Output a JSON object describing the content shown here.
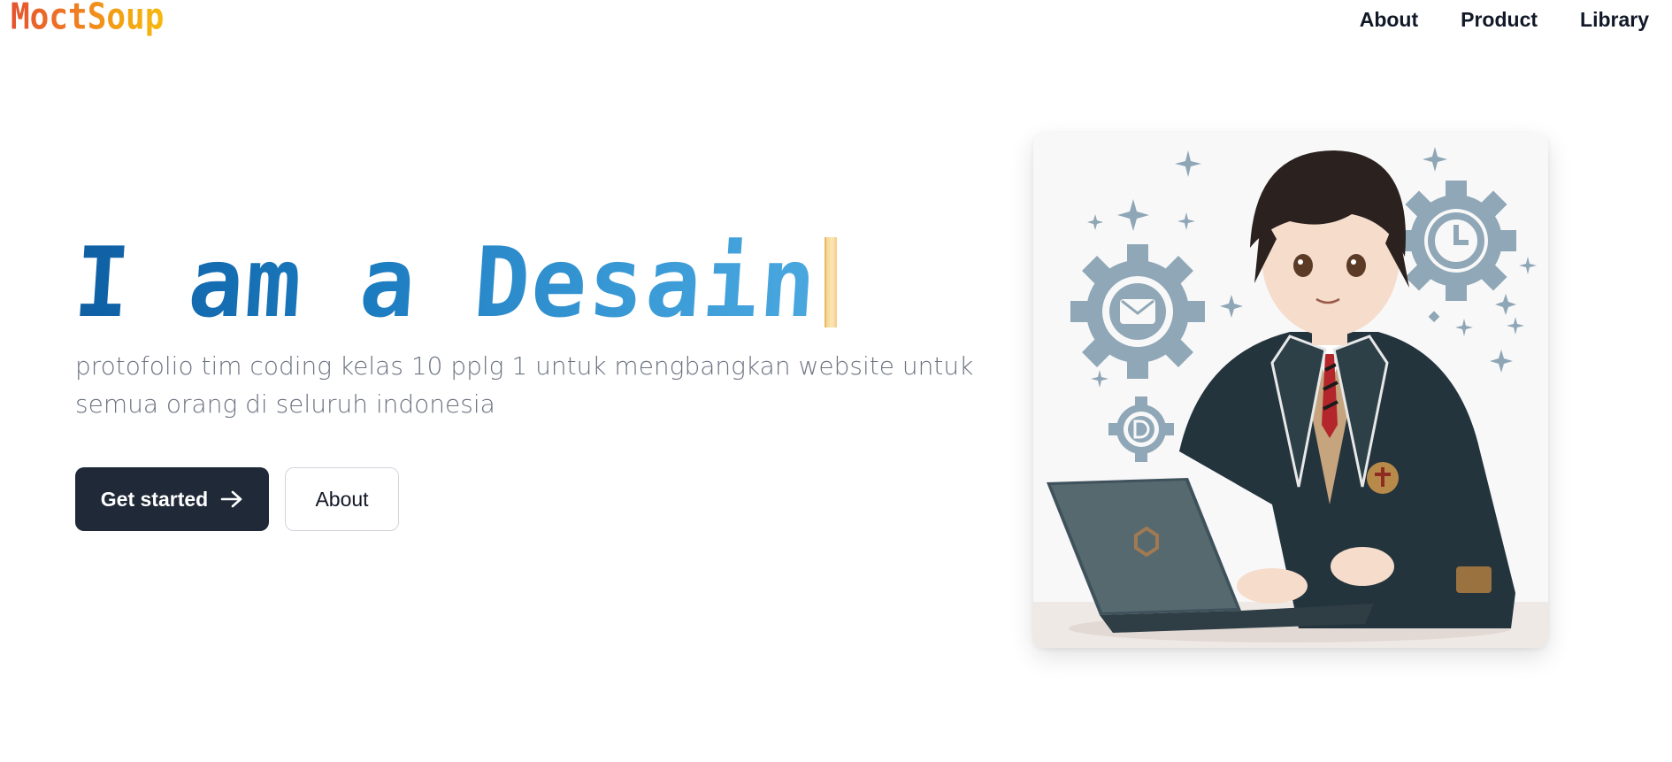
{
  "header": {
    "logo_text": "MoctSoup",
    "nav": [
      {
        "label": "About"
      },
      {
        "label": "Product"
      },
      {
        "label": "Library"
      }
    ]
  },
  "hero": {
    "title": "I am a Desain",
    "description": "protofolio tim coding kelas 10 pplg 1 untuk mengbangkan website untuk semua orang di seluruh indonesia",
    "primary_button": "Get started",
    "secondary_button": "About"
  },
  "illustration": {
    "subject": "anime student in school blazer typing on laptop with gear icons"
  },
  "icons": {
    "primary_button_icon": "arrow-right-icon"
  },
  "colors": {
    "logo_gradient": [
      "#e4532e",
      "#f6b90e"
    ],
    "title_gradient": [
      "#0f5fa3",
      "#4aa8df"
    ],
    "primary_button_bg": "#1f2937",
    "description_text": "#6b7280"
  }
}
